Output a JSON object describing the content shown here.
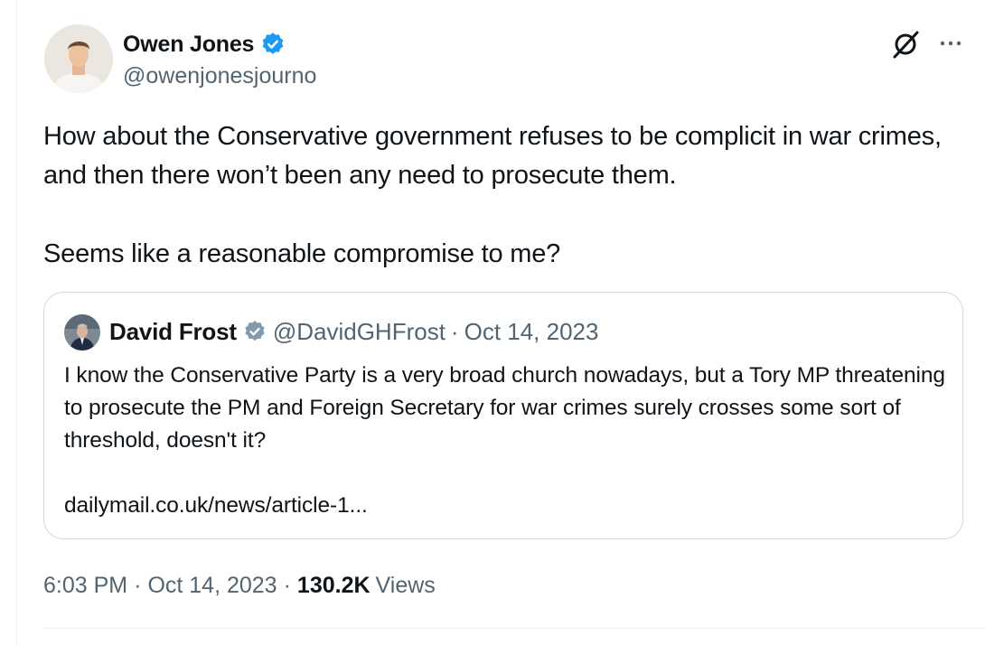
{
  "tweet": {
    "author": {
      "name": "Owen Jones",
      "handle": "@owenjonesjourno",
      "verified": true,
      "avatar_icon": "person-avatar"
    },
    "text_paragraphs": [
      "How about the Conservative government refuses to be complicit in war crimes, and then there won’t been any need to prosecute them.",
      "Seems like a reasonable compromise to me?"
    ],
    "quoted": {
      "name": "David Frost",
      "handle": "@DavidGHFrost",
      "separator": "·",
      "date": "Oct 14, 2023",
      "verified": true,
      "avatar_icon": "person-avatar",
      "text_paragraphs": [
        "I know the Conservative Party is a very broad church nowadays, but a Tory MP threatening to prosecute the PM and Foreign Secretary for war crimes surely crosses some sort of threshold, doesn't it?",
        "dailymail.co.uk/news/article-1..."
      ]
    },
    "meta": {
      "time": "6:03 PM",
      "separator": "·",
      "date": "Oct 14, 2023",
      "views_count": "130.2K",
      "views_label": "Views"
    },
    "icons": {
      "verified": "verified-badge-icon",
      "grok": "grok-icon",
      "more": "more-options-icon"
    }
  },
  "colors": {
    "text": "#0f1419",
    "secondary_text": "#536471",
    "verified_blue": "#1d9bf0",
    "verified_gray": "#829aab",
    "border": "#cfd9de"
  }
}
